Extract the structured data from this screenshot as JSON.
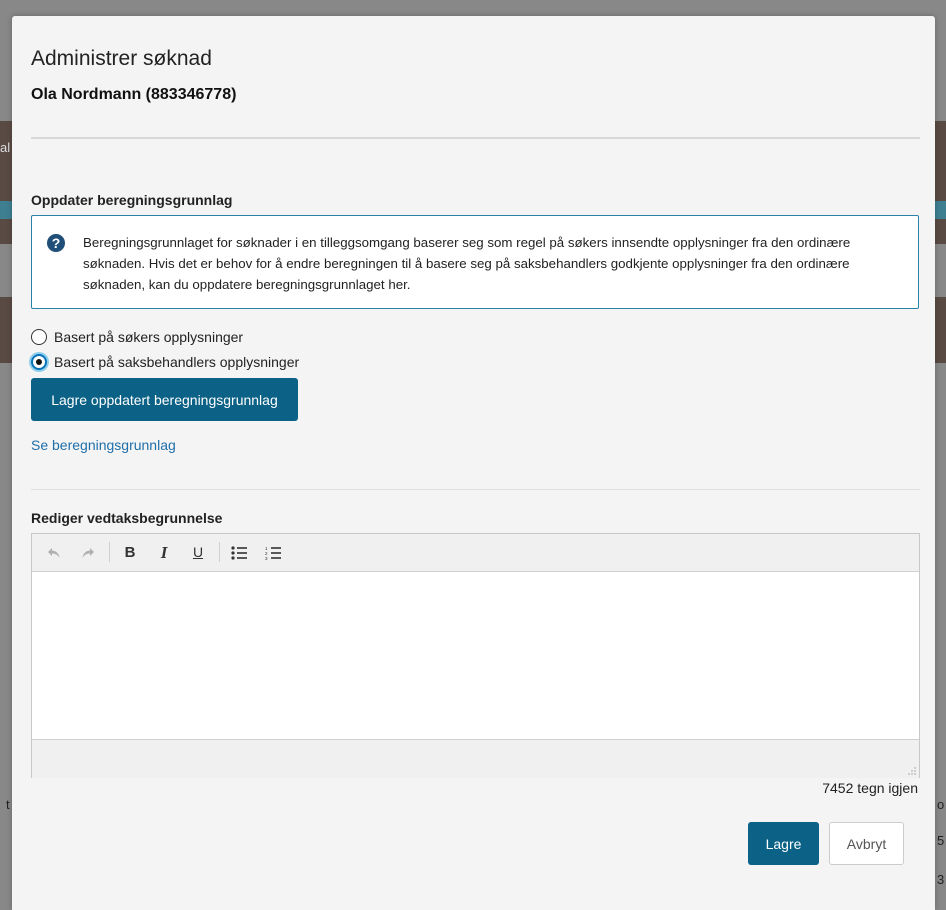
{
  "background": {
    "edge_texts": [
      "al",
      "t",
      "o",
      "5",
      "3"
    ]
  },
  "modal": {
    "title": "Administrer søknad",
    "subtitle": "Ola Nordmann (883346778)",
    "section_calc": {
      "title": "Oppdater beregningsgrunnlag",
      "info_icon": "question-circle-icon",
      "info_text": "Beregningsgrunnlaget for søknader i en tilleggsomgang baserer seg som regel på søkers innsendte opplysninger fra den ordinære søknaden. Hvis det er behov for å endre beregningen til å basere seg på saksbehandlers godkjente opplysninger fra den ordinære søknaden, kan du oppdatere beregningsgrunnlaget her.",
      "options": [
        {
          "label": "Basert på søkers opplysninger",
          "checked": false
        },
        {
          "label": "Basert på saksbehandlers opplysninger",
          "checked": true
        }
      ],
      "save_button": "Lagre oppdatert beregningsgrunnlag",
      "link": "Se beregningsgrunnlag"
    },
    "section_editor": {
      "title": "Rediger vedtaksbegrunnelse",
      "toolbar": {
        "undo_icon": "undo-icon",
        "redo_icon": "redo-icon",
        "bold": "B",
        "italic": "I",
        "underline": "U",
        "bullet_list_icon": "bullet-list-icon",
        "numbered_list_icon": "numbered-list-icon"
      },
      "content": "",
      "counter": "7452 tegn igjen"
    },
    "footer": {
      "save": "Lagre",
      "cancel": "Avbryt"
    }
  },
  "colors": {
    "primary": "#0b6186",
    "link": "#1f6fab",
    "info_border": "#2a82a9",
    "radio_focus": "#0b73b8"
  }
}
